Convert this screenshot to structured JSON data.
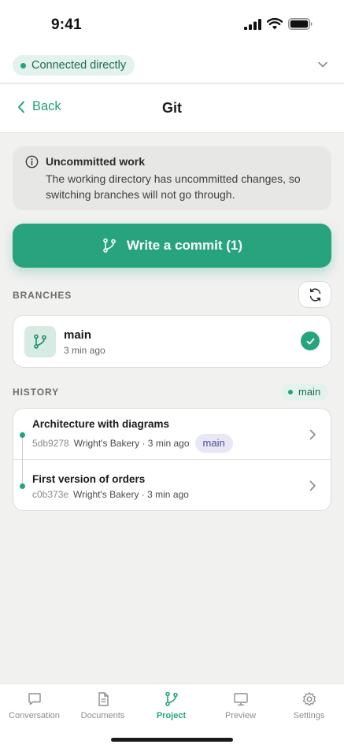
{
  "status_bar": {
    "time": "9:41"
  },
  "connection": {
    "label": "Connected directly"
  },
  "nav": {
    "back_label": "Back",
    "title": "Git"
  },
  "warning": {
    "title": "Uncommitted work",
    "body": "The working directory has uncommitted changes, so switching branches will not go through."
  },
  "commit_button": {
    "label": "Write a commit (1)"
  },
  "branches": {
    "section_label": "BRANCHES",
    "items": [
      {
        "name": "main",
        "time": "3 min ago",
        "current": true
      }
    ]
  },
  "history": {
    "section_label": "HISTORY",
    "current_branch": "main",
    "commits": [
      {
        "title": "Architecture with diagrams",
        "hash": "5db9278",
        "meta": "Wright's Bakery · 3 min ago",
        "branch_tag": "main"
      },
      {
        "title": "First version of orders",
        "hash": "c0b373e",
        "meta": "Wright's Bakery · 3 min ago"
      }
    ]
  },
  "tabs": [
    {
      "label": "Conversation",
      "icon": "chat-bubble-icon",
      "active": false
    },
    {
      "label": "Documents",
      "icon": "document-icon",
      "active": false
    },
    {
      "label": "Project",
      "icon": "git-branch-icon",
      "active": true
    },
    {
      "label": "Preview",
      "icon": "monitor-icon",
      "active": false
    },
    {
      "label": "Settings",
      "icon": "gear-icon",
      "active": false
    }
  ],
  "colors": {
    "accent": "#27a37e",
    "accent_soft": "#e3f2ec",
    "tag_bg": "#e8e7f4",
    "tag_text": "#4b4b9a"
  }
}
